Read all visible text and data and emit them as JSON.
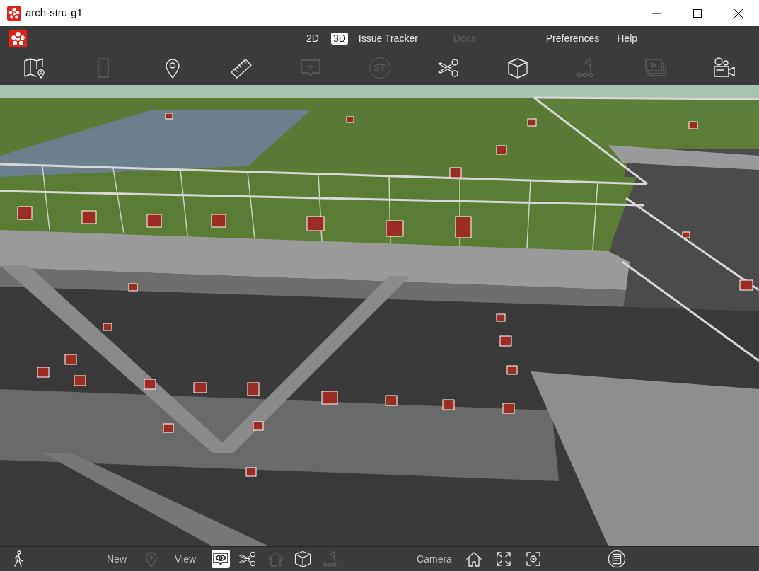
{
  "window": {
    "title": "arch-stru-g1"
  },
  "menu": [
    {
      "label": "2D",
      "selected": false,
      "disabled": false
    },
    {
      "label": "3D",
      "selected": true
    },
    {
      "label": "Issue Tracker",
      "selected": false,
      "disabled": false
    },
    {
      "label": "Docs",
      "selected": false,
      "disabled": true
    },
    {
      "label": "Preferences",
      "selected": false,
      "disabled": false
    },
    {
      "label": "Help",
      "selected": false,
      "disabled": false
    }
  ],
  "toolbar": [
    {
      "kind": "map",
      "disabled": false
    },
    {
      "kind": "door",
      "disabled": true
    },
    {
      "kind": "pin",
      "disabled": false
    },
    {
      "kind": "ruler",
      "disabled": false
    },
    {
      "kind": "comment",
      "disabled": true
    },
    {
      "kind": "badge",
      "label": "ST",
      "disabled": true
    },
    {
      "kind": "scissors",
      "disabled": false
    },
    {
      "kind": "cube",
      "disabled": false
    },
    {
      "kind": "flagpath",
      "disabled": true
    },
    {
      "kind": "slides",
      "disabled": true
    },
    {
      "kind": "camera",
      "disabled": false
    }
  ],
  "bottom_bar": [
    {
      "kind": "walk",
      "disabled": false,
      "selected": false
    },
    {
      "kind": "label",
      "label": "New"
    },
    {
      "kind": "pinplus",
      "disabled": true,
      "selected": false
    },
    {
      "kind": "label",
      "label": "View"
    },
    {
      "kind": "eye",
      "selected": true
    },
    {
      "kind": "scissors",
      "disabled": false,
      "selected": false
    },
    {
      "kind": "house",
      "disabled": true,
      "selected": false
    },
    {
      "kind": "cube",
      "disabled": false,
      "selected": false
    },
    {
      "kind": "flagpath",
      "disabled": true,
      "selected": false
    },
    {
      "kind": "label",
      "label": "Camera"
    },
    {
      "kind": "home",
      "disabled": false,
      "selected": false
    },
    {
      "kind": "expand",
      "disabled": false,
      "selected": false
    },
    {
      "kind": "focus",
      "disabled": false,
      "selected": false
    },
    {
      "kind": "list",
      "disabled": false,
      "selected": false
    }
  ]
}
